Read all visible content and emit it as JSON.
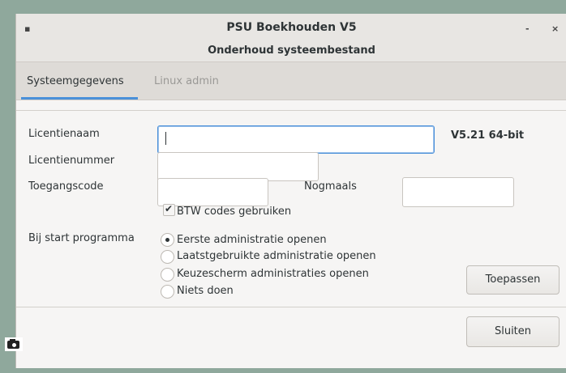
{
  "window": {
    "title": "PSU Boekhouden V5",
    "subtitle": "Onderhoud systeembestand",
    "menu_glyph": "▪",
    "minimize_glyph": "-",
    "close_glyph": "×"
  },
  "tabs": [
    {
      "label": "Systeemgegevens",
      "active": true
    },
    {
      "label": "Linux admin",
      "active": false
    }
  ],
  "form": {
    "licentienaam_label": "Licentienaam",
    "licentienaam_value": "",
    "licentienummer_label": "Licentienummer",
    "licentienummer_value": "",
    "toegangscode_label": "Toegangscode",
    "toegangscode_value": "",
    "nogmaals_label": "Nogmaals",
    "nogmaals_value": "",
    "version": "V5.21  64-bit",
    "btw_label": "BTW codes gebruiken",
    "btw_checked": true,
    "start_label": "Bij start programma",
    "start_options": [
      {
        "label": "Eerste administratie openen",
        "selected": true
      },
      {
        "label": "Laatstgebruikte administratie openen",
        "selected": false
      },
      {
        "label": "Keuzescherm administraties openen",
        "selected": false
      },
      {
        "label": "Niets doen",
        "selected": false
      }
    ]
  },
  "buttons": {
    "apply": "Toepassen",
    "close": "Sluiten"
  },
  "colors": {
    "accent": "#4a90d9",
    "desktop": "#8fa89c"
  }
}
